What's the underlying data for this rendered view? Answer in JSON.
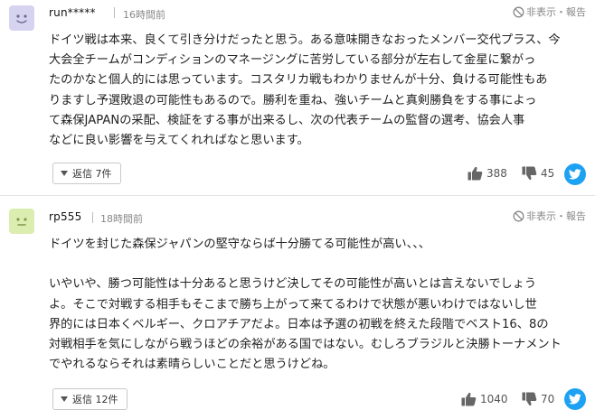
{
  "comments": [
    {
      "avatar_color": "#d6d3f0",
      "username": "run*****",
      "time": "16時間前",
      "report_label": "非表示・報告",
      "lines": [
        "ドイツ戦は本来、良くて引き分けだったと思う。ある意味開きなおったメンバー交代プラス、今",
        "大会全チームがコンディションのマネージングに苦労している部分が左右して金星に繋がっ",
        "たのかなと個人的には思っています。コスタリカ戦もわかりませんが十分、負ける可能性もあ",
        "りますし予選敗退の可能性もあるので。勝利を重ね、強いチームと真剣勝負をする事によっ",
        "て森保JAPANの采配、検証をする事が出来るし、次の代表チームの監督の選考、協会人事",
        "などに良い影響を与えてくれればなと思います。"
      ],
      "reply_label": "返信 7件",
      "likes": "388",
      "dislikes": "45"
    },
    {
      "avatar_color": "#dcedb0",
      "username": "rp555",
      "time": "18時間前",
      "report_label": "非表示・報告",
      "lines": [
        "ドイツを封じた森保ジャパンの堅守ならば十分勝てる可能性が高い、、、",
        "",
        "いやいや、勝つ可能性は十分あると思うけど決してその可能性が高いとは言えないでしょう",
        "よ。そこで対戦する相手もそこまで勝ち上がって来てるわけで状態が悪いわけではないし世",
        "界的には日本くベルギー、クロアチアだよ。日本は予選の初戦を終えた段階でベスト16、8の",
        "対戦相手を気にしながら戦うほどの余裕がある国ではない。むしろブラジルと決勝トーナメント",
        "でやれるならそれは素晴らしいことだと思うけどね。"
      ],
      "reply_label": "返信 12件",
      "likes": "1040",
      "dislikes": "70"
    }
  ],
  "icons": {
    "report": "no-entry-icon",
    "reply_toggle": "triangle-down-icon",
    "like": "thumbs-up-icon",
    "dislike": "thumbs-down-icon",
    "share": "twitter-icon"
  },
  "colors": {
    "twitter": "#1da1f2",
    "vote_icon": "#666666"
  }
}
